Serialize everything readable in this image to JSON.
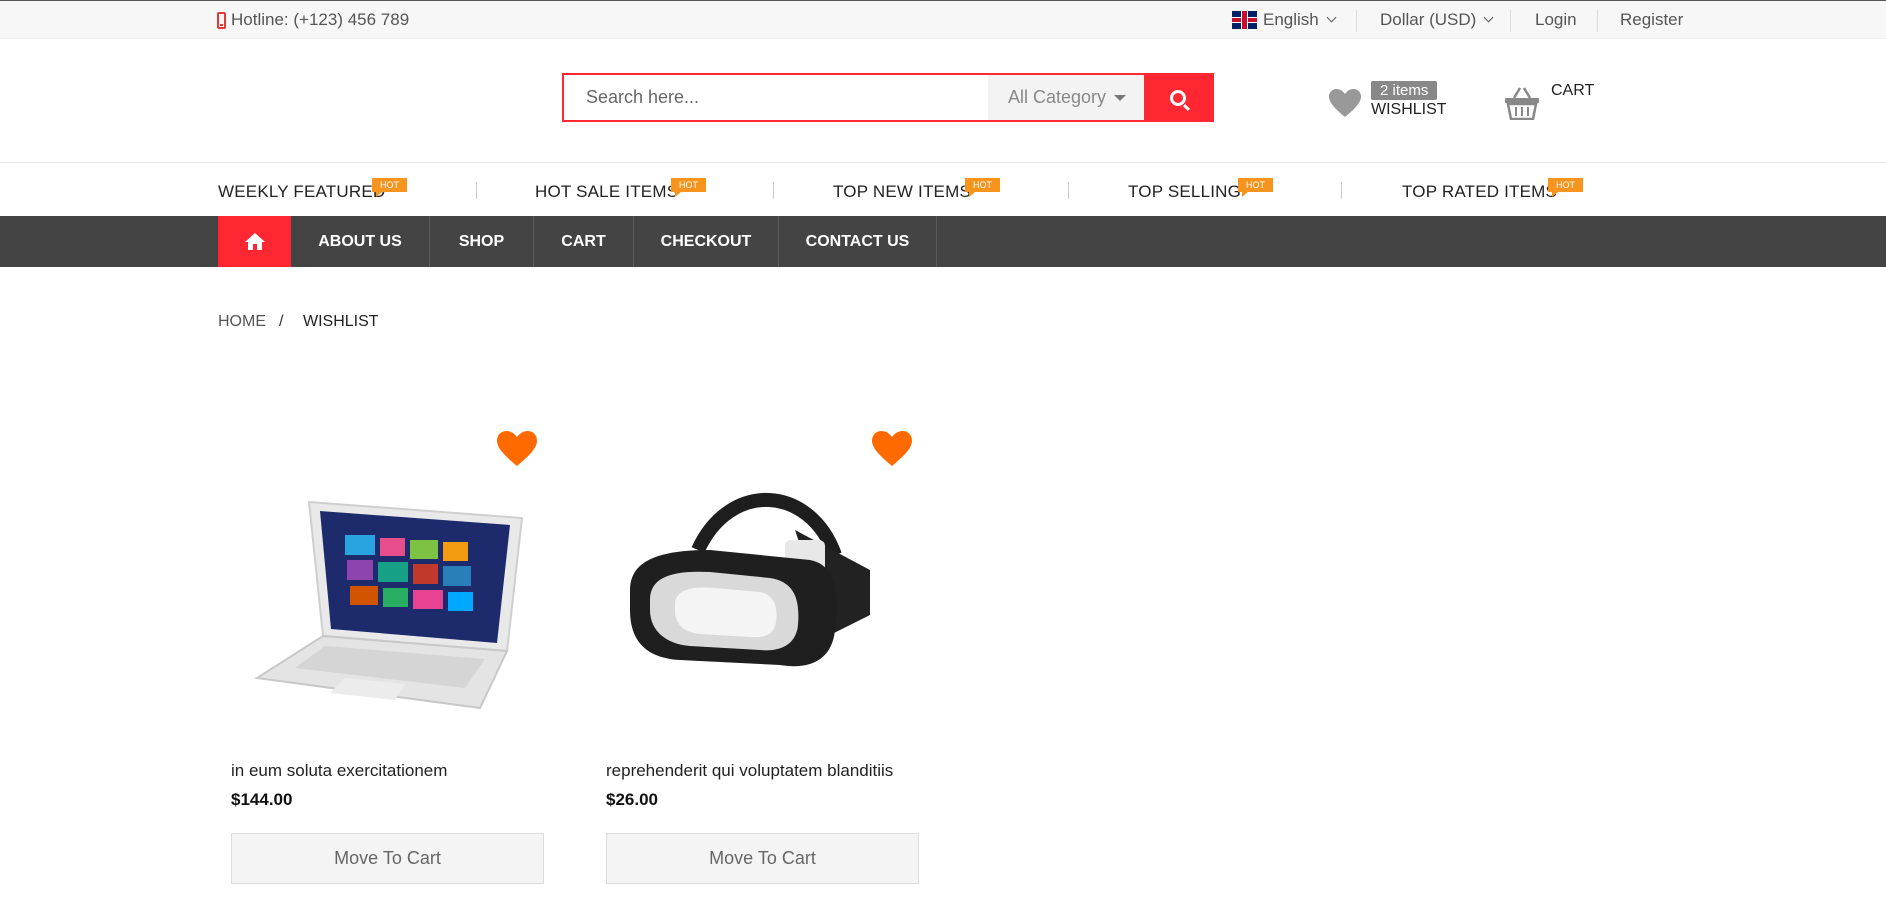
{
  "topbar": {
    "hotline": "Hotline: (+123) 456 789",
    "language": "English",
    "currency": "Dollar (USD)",
    "login": "Login",
    "register": "Register"
  },
  "search": {
    "placeholder": "Search here...",
    "category": "All Category"
  },
  "wishlist": {
    "count": "2 items",
    "label": "WISHLIST"
  },
  "cart": {
    "label": "CART"
  },
  "featured": {
    "items": [
      {
        "label": "WEEKLY FEATURED",
        "badge": "HOT"
      },
      {
        "label": "HOT SALE ITEMS",
        "badge": "HOT"
      },
      {
        "label": "TOP NEW ITEMS",
        "badge": "HOT"
      },
      {
        "label": "TOP SELLING",
        "badge": "HOT"
      },
      {
        "label": "TOP RATED ITEMS",
        "badge": "HOT"
      }
    ]
  },
  "nav": {
    "items": [
      "ABOUT US",
      "SHOP",
      "CART",
      "CHECKOUT",
      "CONTACT US"
    ]
  },
  "breadcrumb": {
    "home": "HOME",
    "separator": "/",
    "current": "WISHLIST"
  },
  "products": [
    {
      "name": "in eum soluta exercitationem",
      "price": "$144.00",
      "button": "Move To Cart"
    },
    {
      "name": "reprehenderit qui voluptatem blanditiis",
      "price": "$26.00",
      "button": "Move To Cart"
    }
  ],
  "colors": {
    "accent": "#ff2832",
    "hot_badge": "#f7941d",
    "wishlist_heart": "#ff6a00",
    "nav_bg": "#444444"
  }
}
